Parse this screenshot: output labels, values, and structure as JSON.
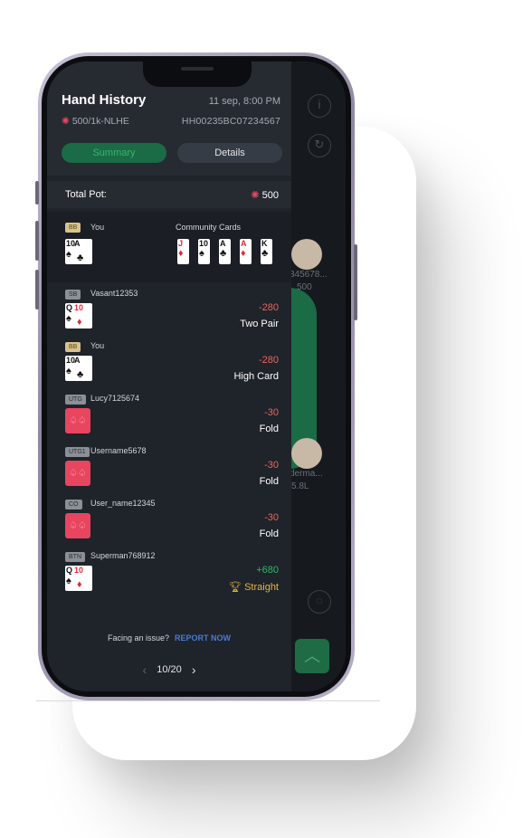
{
  "header": {
    "title": "Hand History",
    "datetime": "11 sep, 8:00 PM",
    "stakes": "500/1k-NLHE",
    "hand_id": "HH00235BC07234567"
  },
  "tabs": [
    {
      "label": "Summary",
      "active": true
    },
    {
      "label": "Details",
      "active": false
    }
  ],
  "pot": {
    "label": "Total Pot:",
    "value": "500"
  },
  "hero": {
    "position": "BB",
    "name": "You",
    "cards": [
      {
        "rank": "10",
        "suit": "♠",
        "color": "black"
      },
      {
        "rank": "A",
        "suit": "♣",
        "color": "black"
      }
    ]
  },
  "community": {
    "label": "Community Cards",
    "cards": [
      {
        "rank": "J",
        "suit": "♦",
        "color": "red"
      },
      {
        "rank": "10",
        "suit": "♠",
        "color": "black"
      },
      {
        "rank": "A",
        "suit": "♣",
        "color": "black"
      },
      {
        "rank": "A",
        "suit": "♦",
        "color": "red"
      },
      {
        "rank": "K",
        "suit": "♣",
        "color": "black"
      }
    ]
  },
  "players": [
    {
      "position": "SB",
      "name": "Vasant12353",
      "cards": [
        {
          "rank": "Q",
          "suit": "♠"
        },
        {
          "rank": "10",
          "suit": "♦"
        }
      ],
      "amount": "-280",
      "result": "Two Pair"
    },
    {
      "position": "BB",
      "name": "You",
      "cards": [
        {
          "rank": "10",
          "suit": "♠"
        },
        {
          "rank": "A",
          "suit": "♣"
        }
      ],
      "amount": "-280",
      "result": "High Card"
    },
    {
      "position": "UTG",
      "name": "Lucy7125674",
      "cards": null,
      "amount": "-30",
      "result": "Fold"
    },
    {
      "position": "UTG1",
      "name": "Username5678",
      "cards": null,
      "amount": "-30",
      "result": "Fold"
    },
    {
      "position": "CO",
      "name": "User_name12345",
      "cards": null,
      "amount": "-30",
      "result": "Fold"
    },
    {
      "position": "BTN",
      "name": "Superman768912",
      "cards": [
        {
          "rank": "Q",
          "suit": "♠"
        },
        {
          "rank": "10",
          "suit": "♦"
        }
      ],
      "amount": "+680",
      "result": "Straight"
    }
  ],
  "footer": {
    "issue_text": "Facing an issue?",
    "report_link": "REPORT NOW",
    "page": "10/20",
    "prev_icon": "chevron-left-icon",
    "next_icon": "chevron-right-icon"
  },
  "background": {
    "seat1_name": "345678...",
    "seat1_stack": "500",
    "seat2_name": "derma...",
    "seat2_stack": "5.8L"
  },
  "colors": {
    "panel_bg": "#1f232a",
    "accent_green": "#37b56b",
    "loss_red": "#e8675c",
    "win_gold": "#e7b53c",
    "chip_red": "#e8455f"
  }
}
